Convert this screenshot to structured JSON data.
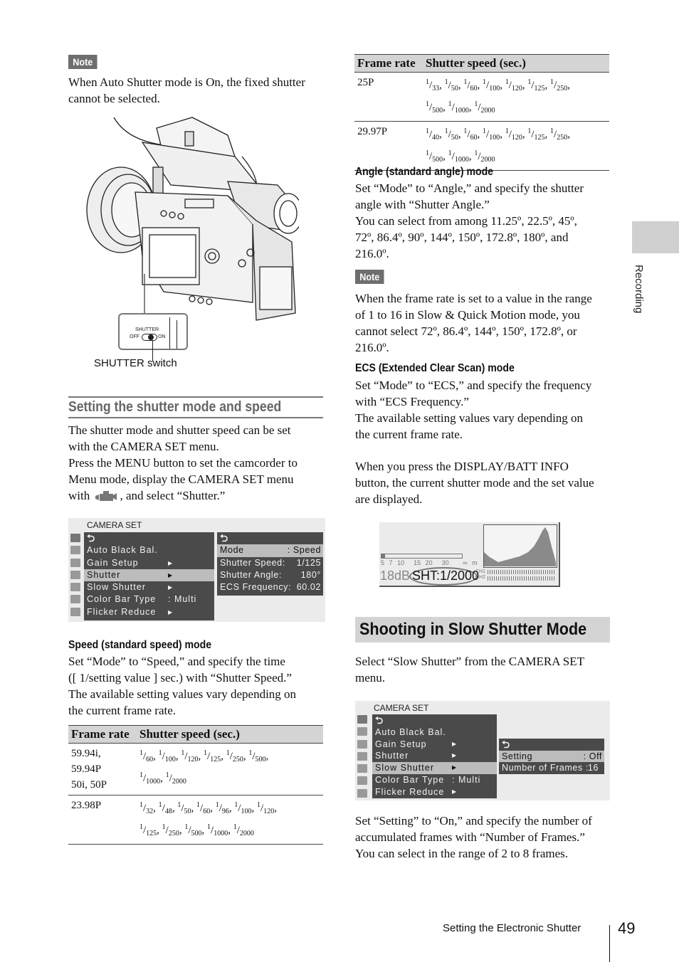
{
  "page": {
    "section_tab": "Recording",
    "footer_title": "Setting the Electronic Shutter",
    "page_number": "49"
  },
  "left": {
    "note1": {
      "label": "Note",
      "text_lines": [
        "When Auto Shutter mode is On, the fixed shutter",
        "cannot be selected."
      ]
    },
    "illustration": {
      "switch_label_title": "SHUTTER",
      "switch_off": "OFF",
      "switch_on": "ON",
      "caption": "SHUTTER switch"
    },
    "section_heading": "Setting the shutter mode and speed",
    "intro_lines": [
      "The shutter mode and shutter speed can be set",
      "with the CAMERA SET menu.",
      "Press the MENU button to set the camcorder to",
      "Menu mode, display the CAMERA SET menu"
    ],
    "intro_with": "with",
    "intro_after_icon": ", and select “Shutter.”",
    "menu1": {
      "title": "CAMERA SET",
      "items": [
        {
          "label": "Auto Black Bal.",
          "arrow": "",
          "value": ""
        },
        {
          "label": "Gain Setup",
          "arrow": "▶",
          "value": ""
        },
        {
          "label": "Shutter",
          "arrow": "▶",
          "value": "",
          "selected": true
        },
        {
          "label": "Slow Shutter",
          "arrow": "▶",
          "value": ""
        },
        {
          "label": "Color Bar Type",
          "arrow": "",
          "value": ": Multi"
        },
        {
          "label": "Flicker Reduce",
          "arrow": "▶",
          "value": ""
        }
      ],
      "submenu": [
        {
          "label": "Mode",
          "value": ":  Speed",
          "selected": true
        },
        {
          "label": "Shutter Speed:",
          "value": "1/125"
        },
        {
          "label": "Shutter Angle:",
          "value": "180°"
        },
        {
          "label": "ECS Frequency:",
          "value": "60.02"
        }
      ]
    },
    "speed_heading": "Speed (standard speed) mode",
    "speed_lines": [
      "Set “Mode” to “Speed,” and specify the time",
      "([ 1/setting value ] sec.) with “Shutter Speed.”",
      "The available setting values vary depending on",
      "the current frame rate."
    ],
    "table": {
      "headers": [
        "Frame rate",
        "Shutter speed (sec.)"
      ],
      "rows": [
        {
          "frame_rate": [
            "59.94i,",
            "59.94P",
            "50i, 50P"
          ],
          "speeds": [
            "60",
            "100",
            "120",
            "125",
            "250",
            "500",
            "1000",
            "2000"
          ]
        },
        {
          "frame_rate": [
            "23.98P"
          ],
          "speeds": [
            "32",
            "48",
            "50",
            "60",
            "96",
            "100",
            "120",
            "125",
            "250",
            "500",
            "1000",
            "2000"
          ]
        }
      ]
    }
  },
  "right": {
    "table": {
      "headers": [
        "Frame rate",
        "Shutter speed (sec.)"
      ],
      "rows": [
        {
          "frame_rate": [
            "25P"
          ],
          "speeds": [
            "33",
            "50",
            "60",
            "100",
            "120",
            "125",
            "250",
            "500",
            "1000",
            "2000"
          ]
        },
        {
          "frame_rate": [
            "29.97P"
          ],
          "speeds": [
            "40",
            "50",
            "60",
            "100",
            "120",
            "125",
            "250",
            "500",
            "1000",
            "2000"
          ]
        }
      ]
    },
    "angle_heading": "Angle (standard angle) mode",
    "angle_lines": [
      "Set “Mode” to “Angle,” and specify the shutter",
      "angle with “Shutter Angle.”",
      "You can select from among 11.25º, 22.5º, 45º,",
      "72º, 86.4º, 90º, 144º, 150º, 172.8º, 180º, and",
      "216.0º."
    ],
    "note2": {
      "label": "Note",
      "text_lines": [
        "When the frame rate is set to a value in the range",
        "of 1 to 16 in Slow & Quick Motion mode, you",
        "cannot select 72º, 86.4º, 144º, 150º, 172.8º, or",
        "216.0º."
      ]
    },
    "ecs_heading": "ECS (Extended Clear Scan) mode",
    "ecs_lines": [
      "Set “Mode” to “ECS,” and specify the frequency",
      "with “ECS Frequency.”",
      "The available setting values vary depending on",
      "the current frame rate."
    ],
    "display_lines": [
      "When you press the DISPLAY/BATT INFO",
      "button, the current shutter mode and the set value",
      "are displayed."
    ],
    "display": {
      "focus_scale": [
        "5",
        "7",
        "10",
        "15",
        "20",
        "30",
        "∞",
        "m"
      ],
      "gain": "18dB",
      "shutter": "SHT:1/2000",
      "ch1": "CH1",
      "ch2": "CH2"
    },
    "slow_heading": "Shooting in Slow Shutter Mode",
    "slow_intro_lines": [
      "Select “Slow Shutter” from the CAMERA SET",
      "menu."
    ],
    "menu2": {
      "title": "CAMERA SET",
      "items": [
        {
          "label": "Auto Black Bal.",
          "arrow": "",
          "value": ""
        },
        {
          "label": "Gain Setup",
          "arrow": "▶",
          "value": ""
        },
        {
          "label": "Shutter",
          "arrow": "▶",
          "value": ""
        },
        {
          "label": "Slow Shutter",
          "arrow": "▶",
          "value": "",
          "selected": true
        },
        {
          "label": "Color Bar Type",
          "arrow": "",
          "value": ": Multi"
        },
        {
          "label": "Flicker Reduce",
          "arrow": "▶",
          "value": ""
        }
      ],
      "submenu": [
        {
          "label": "Setting",
          "value": ": Off",
          "selected": true
        },
        {
          "label": "Number of Frames :",
          "value": "16"
        }
      ]
    },
    "slow_lines": [
      "Set “Setting” to “On,” and specify the number of",
      "accumulated frames with “Number of Frames.”",
      "You can select in the range of 2 to 8 frames."
    ]
  }
}
